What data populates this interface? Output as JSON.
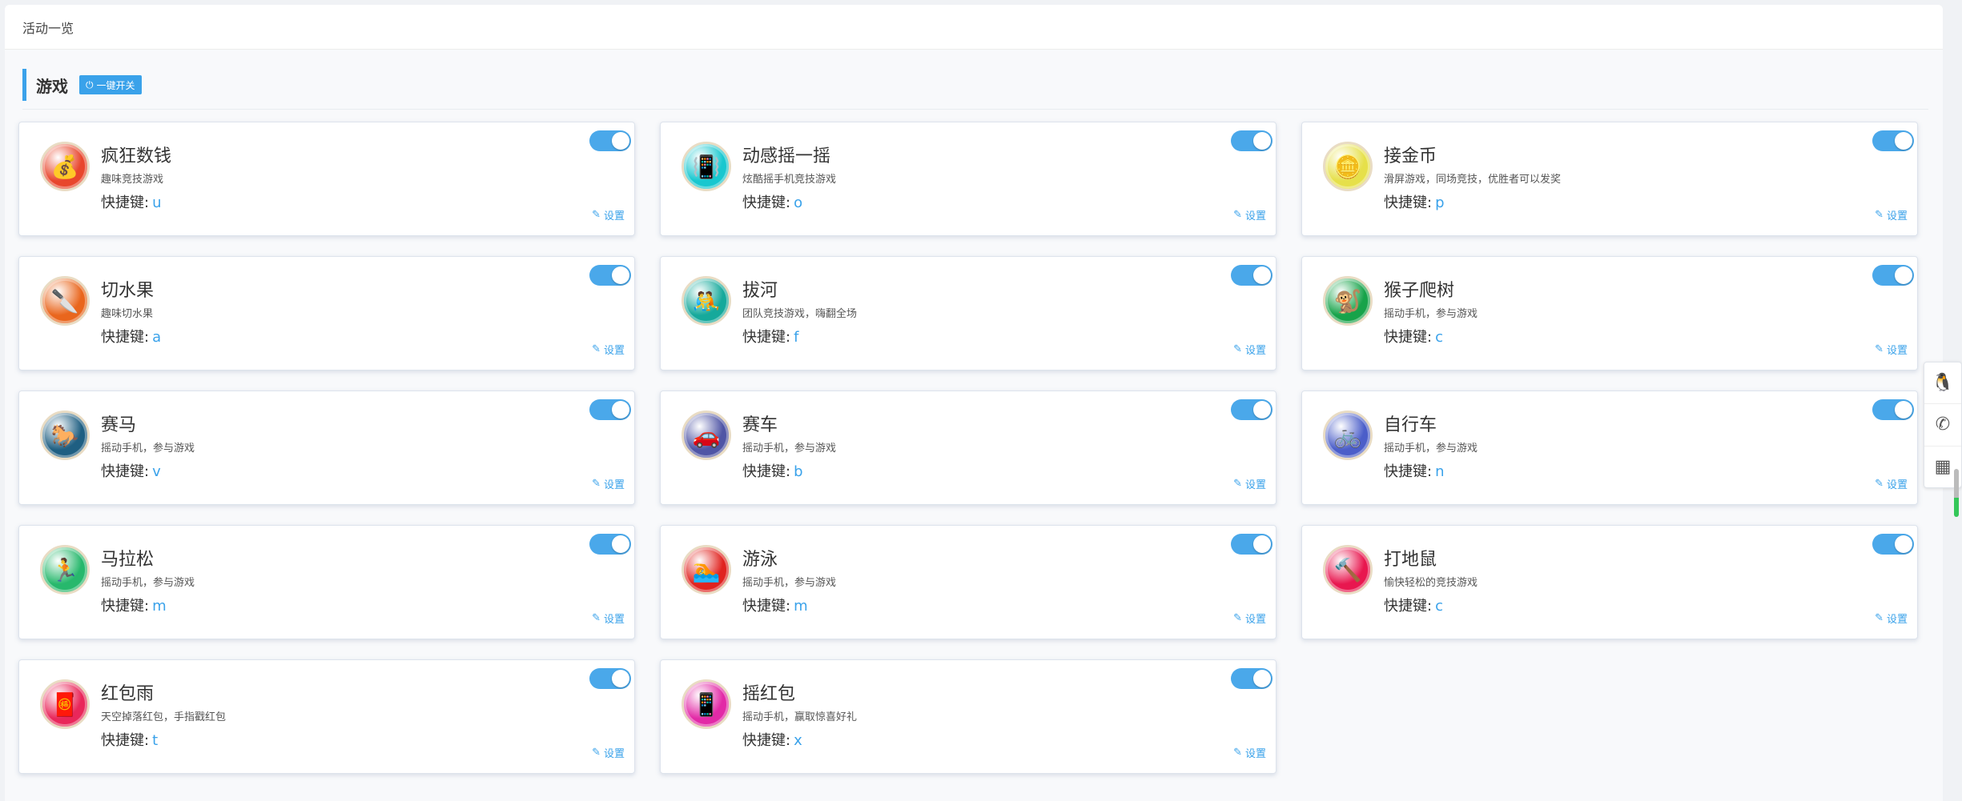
{
  "header": {
    "title": "活动一览"
  },
  "section": {
    "title": "游戏",
    "toggle_all_label": "一键开关"
  },
  "settings_label": "设置",
  "hotkey_label": "快捷键:",
  "games": [
    {
      "name": "疯狂数钱",
      "desc": "趣味竞技游戏",
      "hotkey": "u",
      "icon": "money-bag-icon",
      "glyph": "💰",
      "color": "#e8462c",
      "enabled": true
    },
    {
      "name": "动感摇一摇",
      "desc": "炫酷摇手机竞技游戏",
      "hotkey": "o",
      "icon": "shake-phone-icon",
      "glyph": "📳",
      "color": "#18c7cf",
      "enabled": true
    },
    {
      "name": "接金币",
      "desc": "滑屏游戏，同场竞技，优胜者可以发奖",
      "hotkey": "p",
      "icon": "coin-stack-icon",
      "glyph": "🪙",
      "color": "#e6e04a",
      "enabled": true
    },
    {
      "name": "切水果",
      "desc": "趣味切水果",
      "hotkey": "a",
      "icon": "fruit-knife-icon",
      "glyph": "🔪",
      "color": "#e9661d",
      "enabled": true
    },
    {
      "name": "拔河",
      "desc": "团队竞技游戏，嗨翻全场",
      "hotkey": "f",
      "icon": "tug-of-war-icon",
      "glyph": "🤼",
      "color": "#16a99b",
      "enabled": true
    },
    {
      "name": "猴子爬树",
      "desc": "摇动手机，参与游戏",
      "hotkey": "c",
      "icon": "monkey-climb-icon",
      "glyph": "🐒",
      "color": "#17a34a",
      "enabled": true
    },
    {
      "name": "赛马",
      "desc": "摇动手机，参与游戏",
      "hotkey": "v",
      "icon": "horse-icon",
      "glyph": "🐎",
      "color": "#1f5f82",
      "enabled": true
    },
    {
      "name": "赛车",
      "desc": "摇动手机，参与游戏",
      "hotkey": "b",
      "icon": "car-icon",
      "glyph": "🚗",
      "color": "#4f55a5",
      "enabled": true
    },
    {
      "name": "自行车",
      "desc": "摇动手机，参与游戏",
      "hotkey": "n",
      "icon": "bicycle-icon",
      "glyph": "🚲",
      "color": "#4b5ec9",
      "enabled": true
    },
    {
      "name": "马拉松",
      "desc": "摇动手机，参与游戏",
      "hotkey": "m",
      "icon": "runner-icon",
      "glyph": "🏃",
      "color": "#27b86c",
      "enabled": true
    },
    {
      "name": "游泳",
      "desc": "摇动手机，参与游戏",
      "hotkey": "m",
      "icon": "swimmer-icon",
      "glyph": "🏊",
      "color": "#e0231f",
      "enabled": true
    },
    {
      "name": "打地鼠",
      "desc": "愉快轻松的竞技游戏",
      "hotkey": "c",
      "icon": "whack-mole-icon",
      "glyph": "🔨",
      "color": "#e8174f",
      "enabled": true
    },
    {
      "name": "红包雨",
      "desc": "天空掉落红包，手指戳红包",
      "hotkey": "t",
      "icon": "red-envelope-rain-icon",
      "glyph": "🧧",
      "color": "#e9275a",
      "enabled": true
    },
    {
      "name": "摇红包",
      "desc": "摇动手机，赢取惊喜好礼",
      "hotkey": "x",
      "icon": "shake-red-envelope-icon",
      "glyph": "📱",
      "color": "#e22aa6",
      "enabled": true
    }
  ],
  "floating_bar": [
    {
      "icon": "qq-icon",
      "glyph": "🐧"
    },
    {
      "icon": "phone-icon",
      "glyph": "✆"
    },
    {
      "icon": "qr-code-icon",
      "glyph": "▦"
    }
  ]
}
